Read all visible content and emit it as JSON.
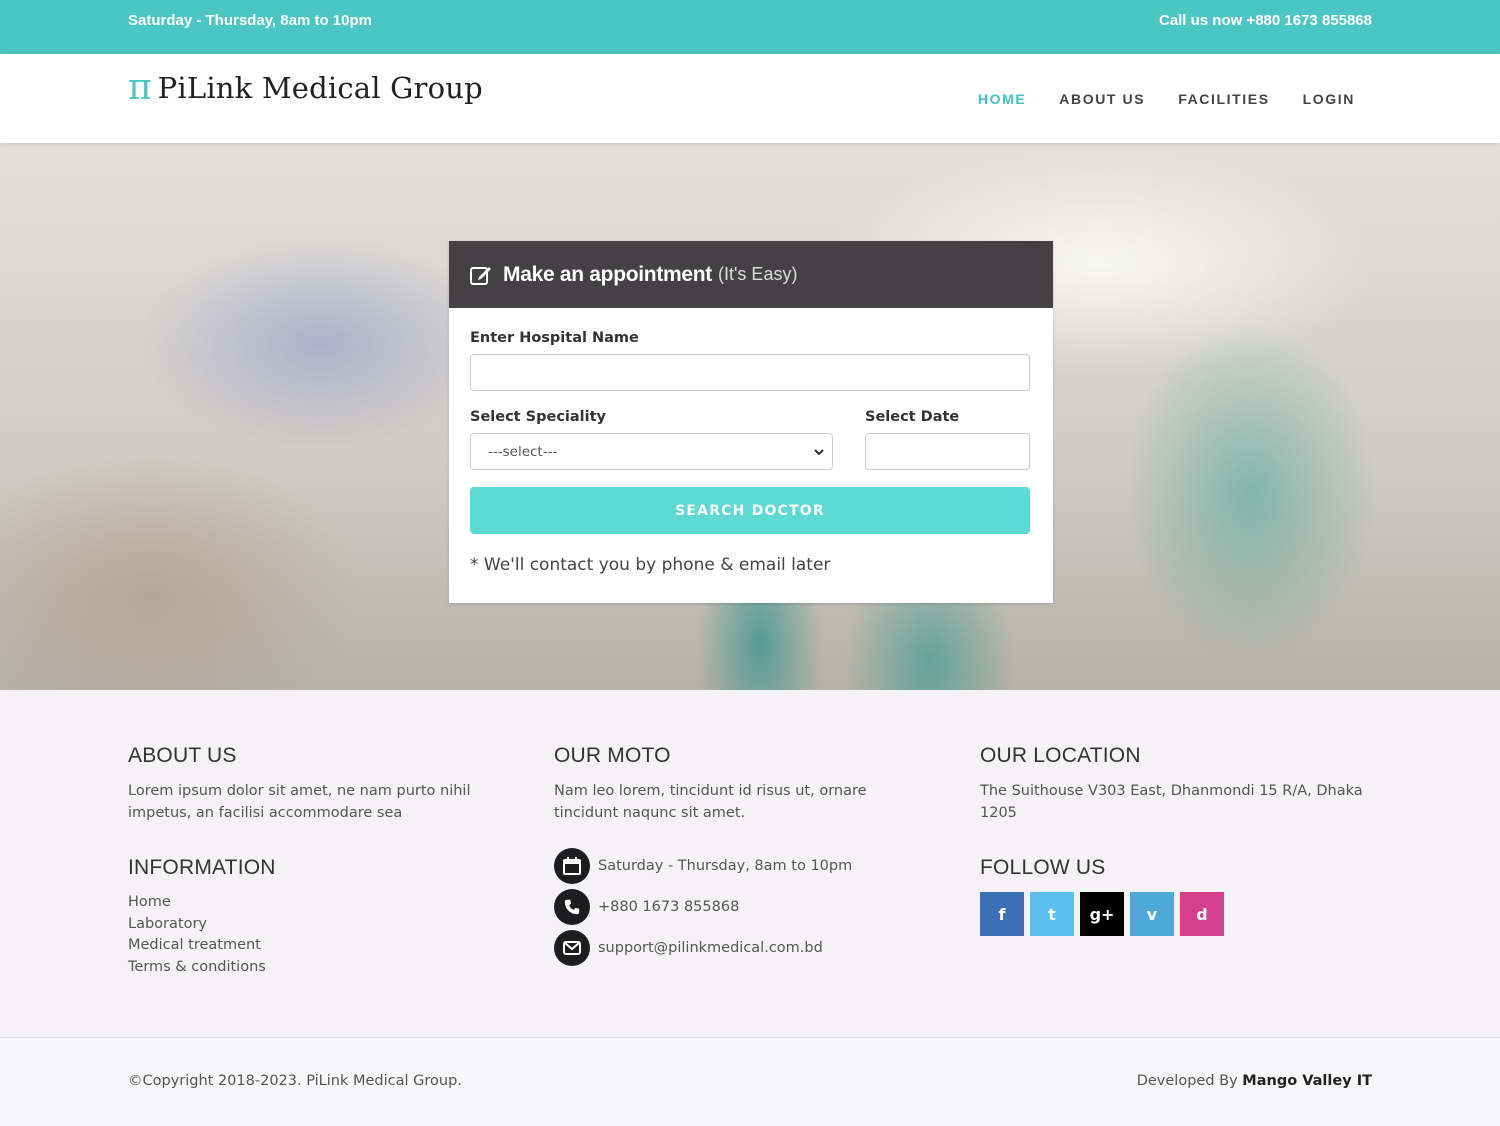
{
  "topbar": {
    "hours": "Saturday - Thursday, 8am to 10pm",
    "call": "Call us now +880 1673 855868"
  },
  "brand": {
    "logo_glyph": "π",
    "name": "PiLink Medical Group",
    "accent": "#4cc6c2"
  },
  "nav": [
    {
      "label": "HOME",
      "active": true
    },
    {
      "label": "ABOUT US",
      "active": false
    },
    {
      "label": "FACILITIES",
      "active": false
    },
    {
      "label": "LOGIN",
      "active": false
    }
  ],
  "appointment": {
    "icon": "edit-icon",
    "title": "Make an appointment",
    "subtitle": "(It's Easy)",
    "hospital_label": "Enter Hospital Name",
    "hospital_value": "",
    "speciality_label": "Select Speciality",
    "speciality_selected": "---select---",
    "date_label": "Select Date",
    "date_value": "",
    "button": "SEARCH DOCTOR",
    "button_color": "#5cd9d2",
    "note": "* We'll contact you by phone & email later"
  },
  "footer": {
    "about": {
      "heading": "ABOUT US",
      "text": "Lorem ipsum dolor sit amet, ne nam purto nihil impetus, an facilisi accommodare sea"
    },
    "info": {
      "heading": "INFORMATION",
      "links": [
        "Home",
        "Laboratory",
        "Medical treatment",
        "Terms & conditions"
      ]
    },
    "moto": {
      "heading": "OUR MOTO",
      "text": "Nam leo lorem, tincidunt id risus ut, ornare tincidunt naqunc sit amet."
    },
    "contacts": [
      {
        "icon": "calendar-icon",
        "text": "Saturday - Thursday, 8am to 10pm"
      },
      {
        "icon": "phone-icon",
        "text": "+880 1673 855868"
      },
      {
        "icon": "envelope-icon",
        "text": "support@pilinkmedical.com.bd"
      }
    ],
    "location": {
      "heading": "OUR LOCATION",
      "text": "The Suithouse V303 East, Dhanmondi 15 R/A, Dhaka 1205"
    },
    "follow": {
      "heading": "FOLLOW US",
      "items": [
        {
          "icon": "facebook-icon",
          "glyph": "f",
          "color": "#3b6fb6"
        },
        {
          "icon": "twitter-icon",
          "glyph": "t",
          "color": "#5bc0ee"
        },
        {
          "icon": "google-plus-icon",
          "glyph": "g+",
          "color": "#000000"
        },
        {
          "icon": "vimeo-icon",
          "glyph": "v",
          "color": "#4ea8d8"
        },
        {
          "icon": "dribbble-icon",
          "glyph": "d",
          "color": "#d63f8c"
        }
      ]
    }
  },
  "bottom": {
    "copyright": "©Copyright 2018-2023. PiLink Medical Group.",
    "dev_prefix": "Developed By",
    "dev_name": "Mango Valley IT"
  }
}
